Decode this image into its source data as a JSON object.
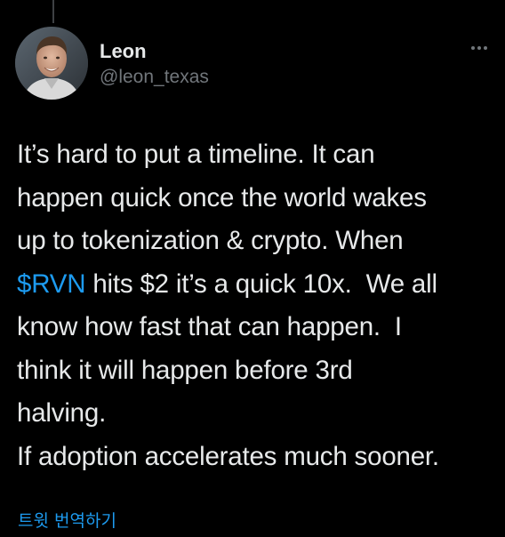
{
  "tweet": {
    "author": {
      "display_name": "Leon",
      "handle": "@leon_texas",
      "avatar": "avatar-photo"
    },
    "more_icon": "more-dots-icon",
    "text_lines": [
      {
        "before": "It’s hard to put a timeline. It can",
        "tag": "",
        "after": ""
      },
      {
        "before": "happen quick once the world wakes",
        "tag": "",
        "after": ""
      },
      {
        "before": "up to tokenization & crypto. When",
        "tag": "",
        "after": ""
      },
      {
        "before": "",
        "tag": "$RVN",
        "after": " hits $2 it’s a quick 10x.  We all"
      },
      {
        "before": "know how fast that can happen.  I",
        "tag": "",
        "after": ""
      },
      {
        "before": "think it will happen before 3rd",
        "tag": "",
        "after": ""
      },
      {
        "before": "halving.",
        "tag": "",
        "after": ""
      },
      {
        "before": "If adoption accelerates much sooner.",
        "tag": "",
        "after": ""
      }
    ],
    "translate_label": "트윗 번역하기"
  },
  "colors": {
    "background": "#000000",
    "text": "#e7e9ea",
    "secondary": "#71767b",
    "link": "#1d9bf0"
  }
}
